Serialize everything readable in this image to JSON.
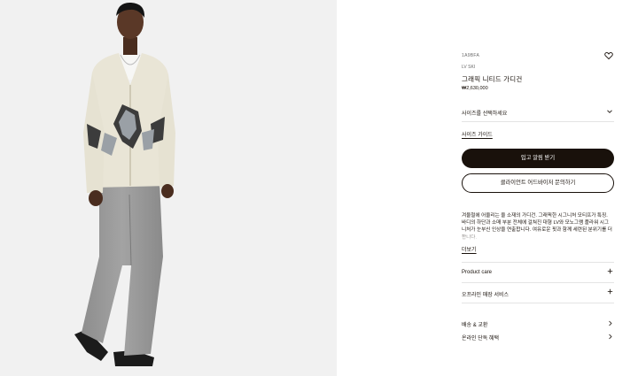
{
  "product": {
    "sku": "1A9BFA",
    "brandline": "LV SKI",
    "title": "그래픽 니티드 가디건",
    "price": "₩2,630,000"
  },
  "size_select": {
    "label": "사이즈를 선택하세요"
  },
  "size_guide": "사이즈 가이드",
  "primary_button": "입고 알림 받기",
  "secondary_button": "클라이언트 어드바이저 문의하기",
  "description": "겨울철에 어울리는 울 소재의 가디건. 그래픽한 시그니처 모티프가 특징. 바디의 하단과 소매 부분 전체에 걸쳐진 대형 LV와 모노그램 플라워 시그니처가 눈부신 인상을 연출합니다. 여유로운 핏과 함께 세련된 분위기를 더합니다.",
  "more_link": "더보기",
  "accordion": [
    {
      "label": "Product care"
    },
    {
      "label": "오프라인 매장 서비스"
    }
  ],
  "links": [
    {
      "label": "배송 & 교환"
    },
    {
      "label": "온라인 단독 혜택"
    }
  ],
  "icons": {
    "wishlist": "heart-icon",
    "size_select": "chevron-down-icon",
    "accordion": "plus-icon",
    "links": "chevron-right-icon"
  },
  "colors": {
    "text": "#19110b",
    "primary_button_bg": "#19110b",
    "photo_bg": "#f1f1f1",
    "divider": "#e4e4e4"
  }
}
